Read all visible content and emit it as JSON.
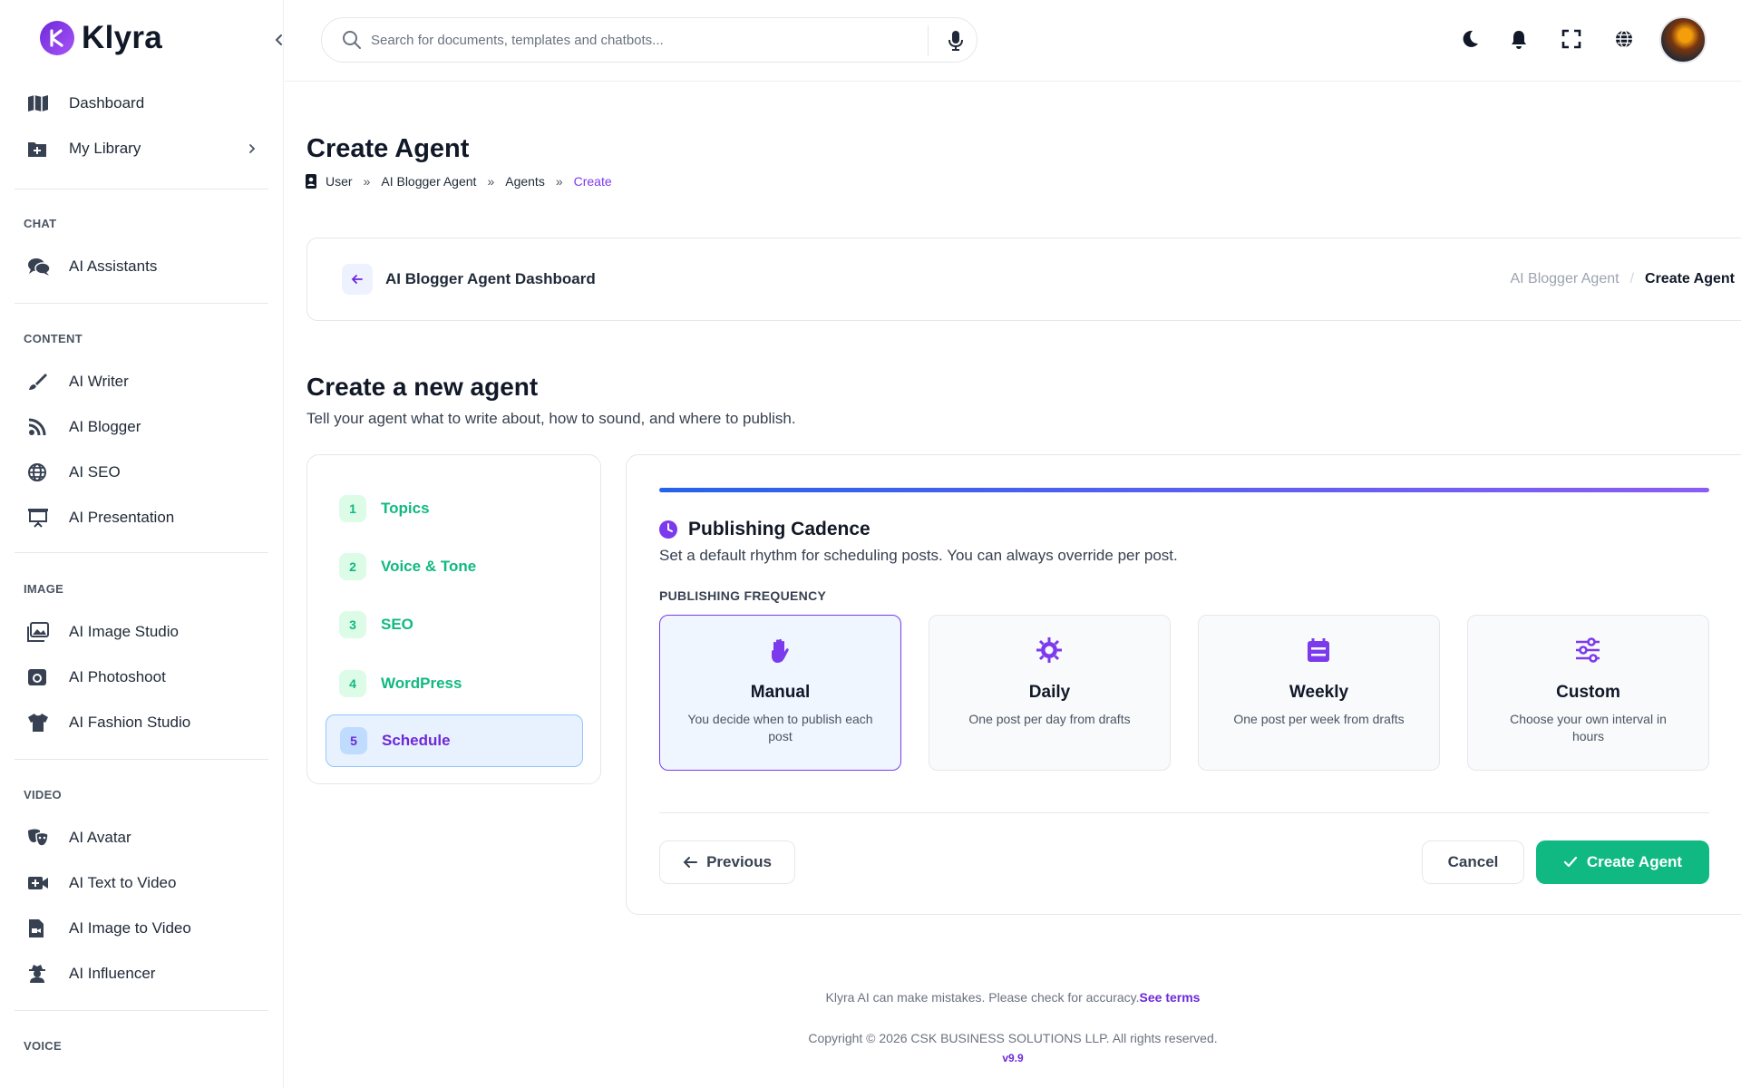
{
  "brand": {
    "name": "Klyra"
  },
  "sidebar": {
    "top_items": [
      {
        "label": "Dashboard",
        "icon": "map-icon"
      },
      {
        "label": "My Library",
        "icon": "folder-plus-icon"
      }
    ],
    "sections": [
      {
        "label": "CHAT",
        "items": [
          {
            "label": "AI Assistants",
            "icon": "chat-bubbles-icon"
          }
        ]
      },
      {
        "label": "CONTENT",
        "items": [
          {
            "label": "AI Writer",
            "icon": "brush-icon"
          },
          {
            "label": "AI Blogger",
            "icon": "rss-icon"
          },
          {
            "label": "AI SEO",
            "icon": "globe-icon"
          },
          {
            "label": "AI Presentation",
            "icon": "presentation-icon"
          }
        ]
      },
      {
        "label": "IMAGE",
        "items": [
          {
            "label": "AI Image Studio",
            "icon": "images-icon"
          },
          {
            "label": "AI Photoshoot",
            "icon": "camera-icon"
          },
          {
            "label": "AI Fashion Studio",
            "icon": "shirt-icon"
          }
        ]
      },
      {
        "label": "VIDEO",
        "items": [
          {
            "label": "AI Avatar",
            "icon": "masks-icon"
          },
          {
            "label": "AI Text to Video",
            "icon": "video-plus-icon"
          },
          {
            "label": "AI Image to Video",
            "icon": "file-video-icon"
          },
          {
            "label": "AI Influencer",
            "icon": "user-secret-icon"
          }
        ]
      },
      {
        "label": "VOICE",
        "items": []
      }
    ]
  },
  "topbar": {
    "search_placeholder": "Search for documents, templates and chatbots..."
  },
  "page": {
    "title": "Create Agent",
    "breadcrumb": [
      "User",
      "AI Blogger Agent",
      "Agents",
      "Create"
    ]
  },
  "dashbar": {
    "title": "AI Blogger Agent Dashboard",
    "crumb_parent": "AI Blogger Agent",
    "crumb_current": "Create Agent"
  },
  "form": {
    "title": "Create a new agent",
    "subtitle": "Tell your agent what to write about, how to sound, and where to publish.",
    "steps": [
      {
        "num": "1",
        "label": "Topics"
      },
      {
        "num": "2",
        "label": "Voice & Tone"
      },
      {
        "num": "3",
        "label": "SEO"
      },
      {
        "num": "4",
        "label": "WordPress"
      },
      {
        "num": "5",
        "label": "Schedule"
      }
    ],
    "active_step": 5,
    "panel": {
      "title": "Publishing Cadence",
      "subtitle": "Set a default rhythm for scheduling posts. You can always override per post.",
      "frequency_label": "PUBLISHING FREQUENCY",
      "options": [
        {
          "title": "Manual",
          "desc": "You decide when to publish each post",
          "icon": "hand-icon",
          "selected": true
        },
        {
          "title": "Daily",
          "desc": "One post per day from drafts",
          "icon": "sun-icon",
          "selected": false
        },
        {
          "title": "Weekly",
          "desc": "One post per week from drafts",
          "icon": "calendar-icon",
          "selected": false
        },
        {
          "title": "Custom",
          "desc": "Choose your own interval in hours",
          "icon": "sliders-icon",
          "selected": false
        }
      ],
      "prev_label": "Previous",
      "cancel_label": "Cancel",
      "create_label": "Create Agent"
    }
  },
  "footer": {
    "note": "Klyra AI can make mistakes. Please check for accuracy.",
    "terms_link": "See terms",
    "copyright": "Copyright © 2026 CSK BUSINESS SOLUTIONS LLP. All rights reserved.",
    "version": "v9.9"
  },
  "colors": {
    "accent": "#6d28d9",
    "success": "#10b981",
    "progress_start": "#2563eb",
    "progress_end": "#8b5cf6"
  }
}
